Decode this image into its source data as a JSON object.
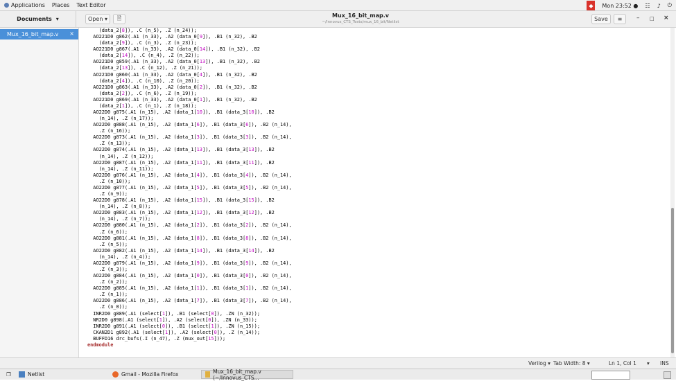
{
  "topbar": {
    "menus": [
      "Applications",
      "Places",
      "Text Editor"
    ],
    "clock": "Mon 23:52 ●",
    "tray_icons": [
      "network-icon",
      "volume-icon",
      "power-icon"
    ]
  },
  "header": {
    "documents_label": "Documents",
    "open_label": "Open",
    "title": "Mux_16_bit_map.v",
    "subtitle": "~/Innovus_CTS_Tests/mux_16_bit/Netlist",
    "save_label": "Save"
  },
  "sidebar": {
    "items": [
      {
        "label": "Mux_16_bit_map.v"
      }
    ]
  },
  "editor": {
    "lines": [
      "    (data_2[8]), .C (n_5), .Z (n_24));",
      "  AO221D0 g862(.A1 (n_33), .A2 (data_0[9]), .B1 (n_32), .B2",
      "    (data_2[9]), .C (n_3), .Z (n_23));",
      "  AO221D0 g867(.A1 (n_33), .A2 (data_0[14]), .B1 (n_32), .B2",
      "    (data_2[14]), .C (n_4), .Z (n_22));",
      "  AO221D0 g859(.A1 (n_33), .A2 (data_0[13]), .B1 (n_32), .B2",
      "    (data_2[13]), .C (n_12), .Z (n_21));",
      "  AO221D0 g860(.A1 (n_33), .A2 (data_0[4]), .B1 (n_32), .B2",
      "    (data_2[4]), .C (n_10), .Z (n_20));",
      "  AO221D0 g863(.A1 (n_33), .A2 (data_0[2]), .B1 (n_32), .B2",
      "    (data_2[2]), .C (n_6), .Z (n_19));",
      "  AO221D0 g869(.A1 (n_33), .A2 (data_0[1]), .B1 (n_32), .B2",
      "    (data_2[1]), .C (n_1), .Z (n_18));",
      "  AO22D0 g875(.A1 (n_15), .A2 (data_1[10]), .B1 (data_3[10]), .B2",
      "    (n_14), .Z (n_17));",
      "  AO22D0 g888(.A1 (n_15), .A2 (data_1[6]), .B1 (data_3[6]), .B2 (n_14),",
      "    .Z (n_16));",
      "  AO22D0 g873(.A1 (n_15), .A2 (data_1[3]), .B1 (data_3[3]), .B2 (n_14),",
      "    .Z (n_13));",
      "  AO22D0 g874(.A1 (n_15), .A2 (data_1[13]), .B1 (data_3[13]), .B2",
      "    (n_14), .Z (n_12));",
      "  AO22D0 g887(.A1 (n_15), .A2 (data_1[11]), .B1 (data_3[11]), .B2",
      "    (n_14), .Z (n_11));",
      "  AO22D0 g876(.A1 (n_15), .A2 (data_1[4]), .B1 (data_3[4]), .B2 (n_14),",
      "    .Z (n_10));",
      "  AO22D0 g877(.A1 (n_15), .A2 (data_1[5]), .B1 (data_3[5]), .B2 (n_14),",
      "    .Z (n_9));",
      "  AO22D0 g878(.A1 (n_15), .A2 (data_1[15]), .B1 (data_3[15]), .B2",
      "    (n_14), .Z (n_8));",
      "  AO22D0 g883(.A1 (n_15), .A2 (data_1[12]), .B1 (data_3[12]), .B2",
      "    (n_14), .Z (n_7));",
      "  AO22D0 g880(.A1 (n_15), .A2 (data_1[2]), .B1 (data_3[2]), .B2 (n_14),",
      "    .Z (n_6));",
      "  AO22D0 g881(.A1 (n_15), .A2 (data_1[8]), .B1 (data_3[8]), .B2 (n_14),",
      "    .Z (n_5));",
      "  AO22D0 g882(.A1 (n_15), .A2 (data_1[14]), .B1 (data_3[14]), .B2",
      "    (n_14), .Z (n_4));",
      "  AO22D0 g879(.A1 (n_15), .A2 (data_1[9]), .B1 (data_3[9]), .B2 (n_14),",
      "    .Z (n_3));",
      "  AO22D0 g884(.A1 (n_15), .A2 (data_1[0]), .B1 (data_3[0]), .B2 (n_14),",
      "    .Z (n_2));",
      "  AO22D0 g885(.A1 (n_15), .A2 (data_1[1]), .B1 (data_3[1]), .B2 (n_14),",
      "    .Z (n_1));",
      "  AO22D0 g886(.A1 (n_15), .A2 (data_1[7]), .B1 (data_3[7]), .B2 (n_14),",
      "    .Z (n_0));",
      "  INR2D0 g889(.A1 (select[1]), .B1 (select[0]), .ZN (n_32));",
      "  NR2D0 g898(.A1 (select[1]), .A2 (select[0]), .ZN (n_33));",
      "  INR2D0 g891(.A1 (select[0]), .B1 (select[1]), .ZN (n_15));",
      "  CKAN2D1 g892(.A1 (select[1]), .A2 (select[0]), .Z (n_14));",
      "  BUFFD16 drc_bufs(.I (n_47), .Z (mux_out[15]));",
      "endmodule"
    ]
  },
  "statusbar": {
    "language": "Verilog ▾",
    "tab_width": "Tab Width: 8 ▾",
    "position": "Ln 1, Col 1",
    "mode": "INS"
  },
  "taskbar": {
    "items": [
      {
        "label": "Netlist"
      },
      {
        "label": "Gmail - Mozilla Firefox"
      },
      {
        "label": "Mux_16_bit_map.v (~/Innovus_CTS..."
      }
    ]
  }
}
